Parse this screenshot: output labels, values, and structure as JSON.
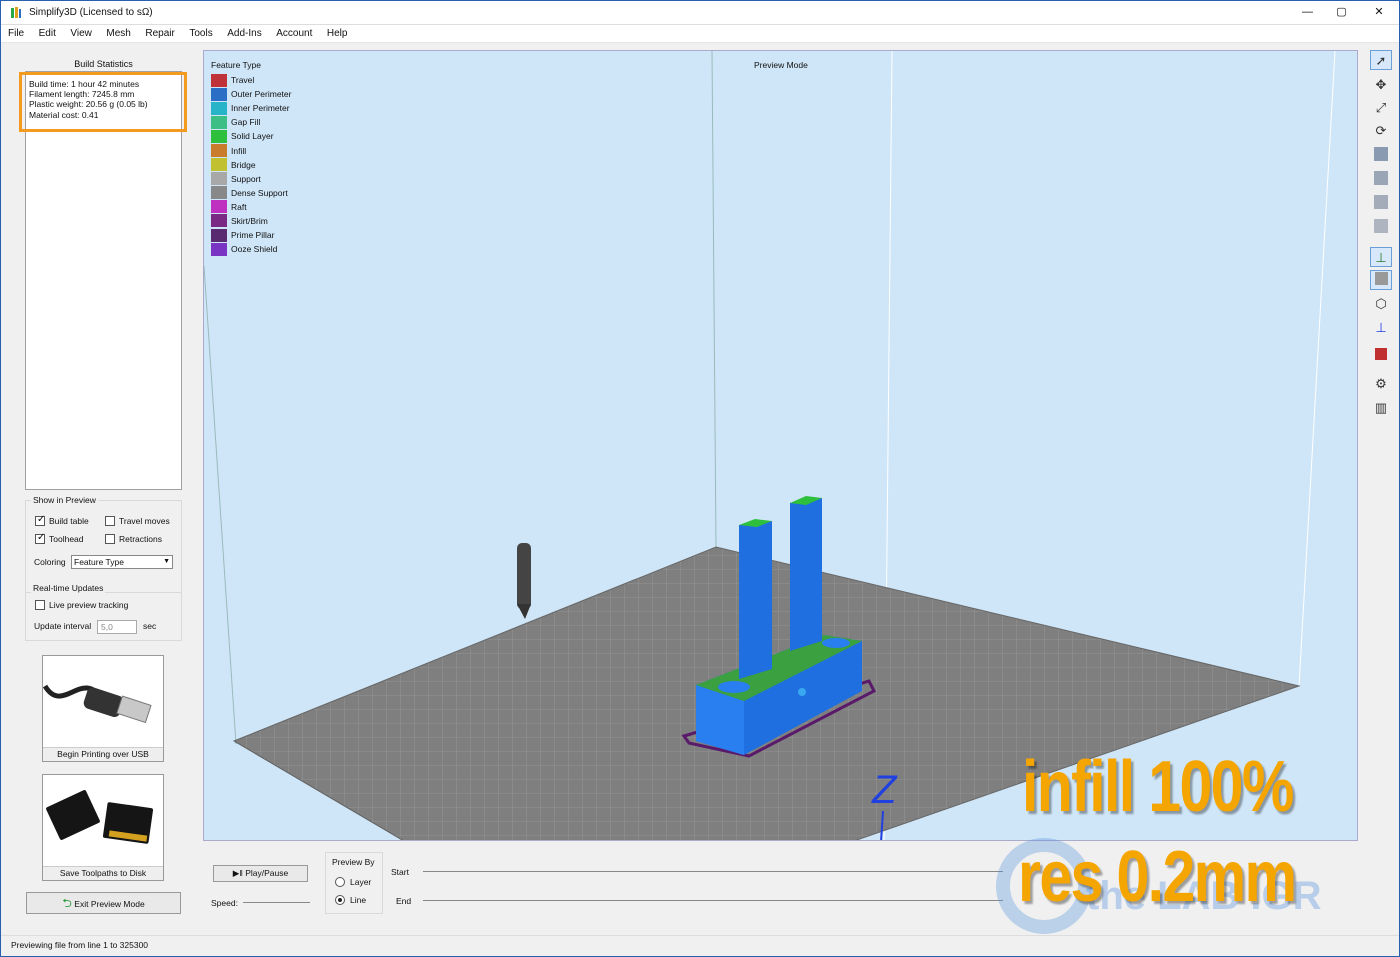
{
  "window": {
    "title": "Simplify3D (Licensed to sΩ)",
    "min": "—",
    "max": "▢",
    "close": "✕"
  },
  "menu": [
    "File",
    "Edit",
    "View",
    "Mesh",
    "Repair",
    "Tools",
    "Add-Ins",
    "Account",
    "Help"
  ],
  "build_statistics": {
    "caption": "Build Statistics",
    "lines": [
      "Build time: 1 hour 42 minutes",
      "Filament length: 7245.8 mm",
      "Plastic weight: 20.56 g (0.05 lb)",
      "Material cost: 0.41"
    ]
  },
  "show_in_preview": {
    "caption": "Show in Preview",
    "build_table": "Build table",
    "build_table_checked": true,
    "travel_moves": "Travel moves",
    "travel_moves_checked": false,
    "toolhead": "Toolhead",
    "toolhead_checked": true,
    "retractions": "Retractions",
    "retractions_checked": false,
    "coloring_label": "Coloring",
    "coloring_value": "Feature Type"
  },
  "realtime": {
    "caption": "Real-time Updates",
    "live_tracking": "Live preview tracking",
    "live_tracking_checked": false,
    "interval_label": "Update interval",
    "interval_value": "5,0",
    "interval_unit": "sec"
  },
  "usb_button": "Begin Printing over USB",
  "disk_button": "Save Toolpaths to Disk",
  "exit_button": "Exit Preview Mode",
  "viewport": {
    "legend_title": "Feature Type",
    "mode_title": "Preview Mode",
    "legend": [
      {
        "label": "Travel",
        "color": "#c0323a"
      },
      {
        "label": "Outer Perimeter",
        "color": "#2a6ec5"
      },
      {
        "label": "Inner Perimeter",
        "color": "#28b4c8"
      },
      {
        "label": "Gap Fill",
        "color": "#3cbe84"
      },
      {
        "label": "Solid Layer",
        "color": "#2ec03c"
      },
      {
        "label": "Infill",
        "color": "#c87c2c"
      },
      {
        "label": "Bridge",
        "color": "#c0c030"
      },
      {
        "label": "Support",
        "color": "#a8a8a8"
      },
      {
        "label": "Dense Support",
        "color": "#888888"
      },
      {
        "label": "Raft",
        "color": "#c030c0"
      },
      {
        "label": "Skirt/Brim",
        "color": "#7a2a84"
      },
      {
        "label": "Prime Pillar",
        "color": "#5a2a70"
      },
      {
        "label": "Ooze Shield",
        "color": "#7a34c4"
      }
    ],
    "axis_label": "Z"
  },
  "right_toolbar": [
    "select-icon",
    "move-icon",
    "scale-icon",
    "rotate-icon",
    "view-top-icon",
    "view-front-icon",
    "view-side-icon",
    "view-iso-icon",
    "axes-icon",
    "solid-view-icon",
    "wireframe-view-icon",
    "normal-icon",
    "cross-section-icon",
    "settings-gear-icon",
    "supports-icon"
  ],
  "bottom": {
    "play_label": "Play/Pause",
    "speed_label": "Speed:",
    "preview_by": "Preview By",
    "layer": "Layer",
    "layer_selected": false,
    "line": "Line",
    "line_selected": true,
    "start_label": "Start",
    "end_label": "End"
  },
  "status": "Previewing file from line 1 to 325300",
  "overlay": {
    "line1": "infill 100%",
    "line2": "res 0.2mm",
    "watermark": "the LAB .GR"
  }
}
